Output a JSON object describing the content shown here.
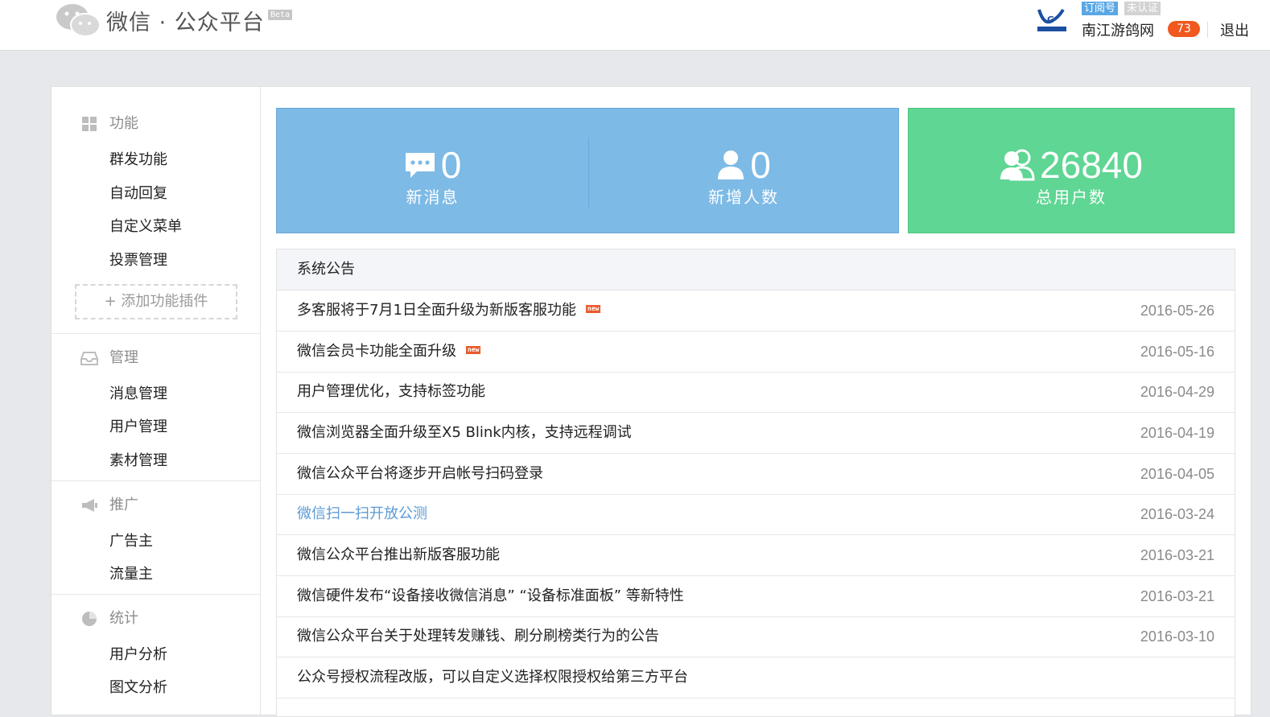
{
  "header": {
    "brand": "微信 · 公众平台",
    "beta": "Beta",
    "account_type": "订阅号",
    "verify_status": "未认证",
    "account_name": "南江游鸽网",
    "message_count": "73",
    "logout": "退出"
  },
  "sidebar": {
    "groups": [
      {
        "title": "功能",
        "icon": "grid-icon",
        "items": [
          "群发功能",
          "自动回复",
          "自定义菜单",
          "投票管理"
        ]
      },
      {
        "title": "管理",
        "icon": "inbox-icon",
        "items": [
          "消息管理",
          "用户管理",
          "素材管理"
        ]
      },
      {
        "title": "推广",
        "icon": "megaphone-icon",
        "items": [
          "广告主",
          "流量主"
        ]
      },
      {
        "title": "统计",
        "icon": "pie-chart-icon",
        "items": [
          "用户分析",
          "图文分析"
        ]
      }
    ],
    "add_plugin": "添加功能插件"
  },
  "stats": {
    "new_messages": {
      "value": "0",
      "label": "新消息"
    },
    "new_users": {
      "value": "0",
      "label": "新增人数"
    },
    "total_users": {
      "value": "26840",
      "label": "总用户数"
    }
  },
  "notice": {
    "title": "系统公告",
    "new_tag": "new",
    "items": [
      {
        "title": "多客服将于7月1日全面升级为新版客服功能",
        "date": "2016-05-26",
        "is_new": true
      },
      {
        "title": "微信会员卡功能全面升级",
        "date": "2016-05-16",
        "is_new": true
      },
      {
        "title": "用户管理优化，支持标签功能",
        "date": "2016-04-29"
      },
      {
        "title": "微信浏览器全面升级至X5 Blink内核，支持远程调试",
        "date": "2016-04-19"
      },
      {
        "title": "微信公众平台将逐步开启帐号扫码登录",
        "date": "2016-04-05"
      },
      {
        "title": "微信扫一扫开放公测",
        "date": "2016-03-24",
        "hovered": true
      },
      {
        "title": "微信公众平台推出新版客服功能",
        "date": "2016-03-21"
      },
      {
        "title": "微信硬件发布“设备接收微信消息” “设备标准面板” 等新特性",
        "date": "2016-03-21"
      },
      {
        "title": "微信公众平台关于处理转发赚钱、刷分刷榜类行为的公告",
        "date": "2016-03-10"
      },
      {
        "title": "公众号授权流程改版，可以自定义选择权限授权给第三方平台",
        "date": ""
      }
    ]
  },
  "colors": {
    "stat_blue": "#7dbae6",
    "stat_green": "#5fd693",
    "badge": "#f0581e",
    "link": "#5c9ad6"
  }
}
